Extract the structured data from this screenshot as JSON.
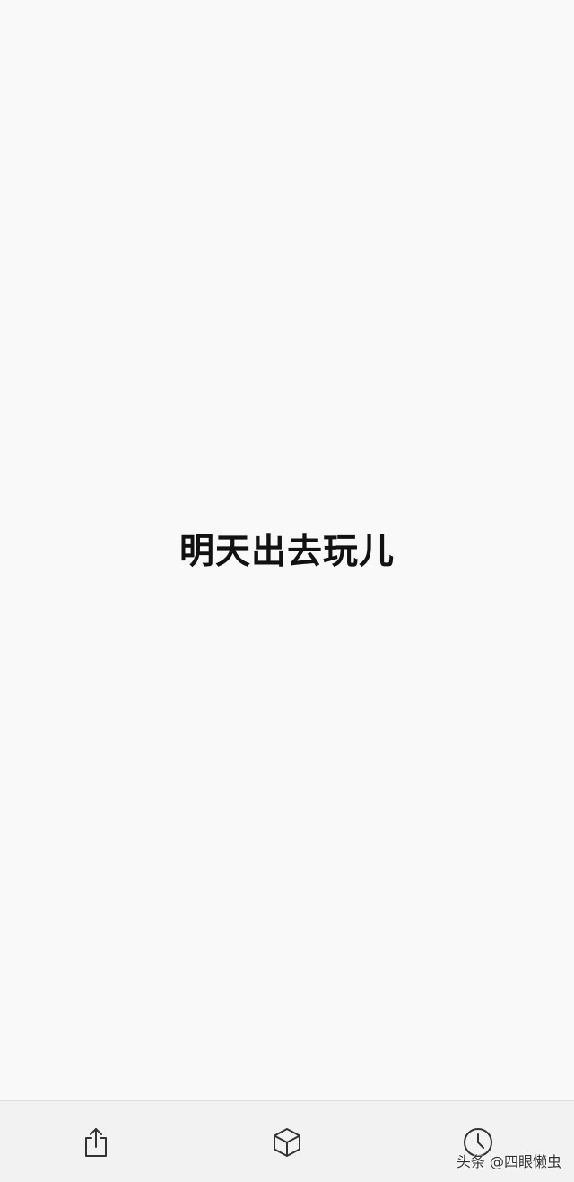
{
  "main": {
    "text": "明天出去玩儿"
  },
  "toolbar": {
    "buttons": [
      {
        "icon": "share-icon"
      },
      {
        "icon": "cube-icon"
      },
      {
        "icon": "clock-icon"
      }
    ]
  },
  "watermark": {
    "text": "头条 @四眼懒虫"
  },
  "colors": {
    "background": "#f9f9f9",
    "toolbar_background": "#f2f2f2",
    "text": "#111111",
    "icon": "#333333"
  }
}
